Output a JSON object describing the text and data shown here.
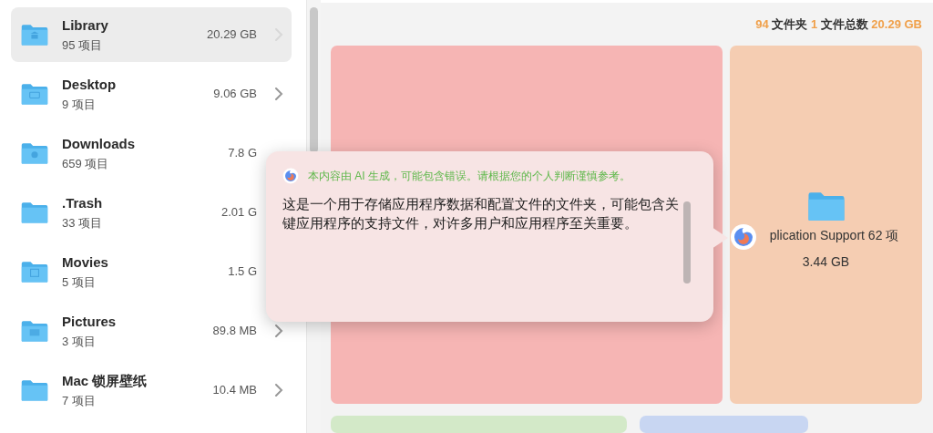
{
  "folders": [
    {
      "name": "Library",
      "count": "95 项目",
      "size": "20.29 GB",
      "kind": "library",
      "selected": true,
      "chevron": true
    },
    {
      "name": "Desktop",
      "count": "9 项目",
      "size": "9.06 GB",
      "kind": "desktop",
      "selected": false,
      "chevron": true
    },
    {
      "name": "Downloads",
      "count": "659 项目",
      "size": "7.8 G",
      "kind": "downloads",
      "selected": false,
      "chevron": false
    },
    {
      "name": ".Trash",
      "count": "33 项目",
      "size": "2.01 G",
      "kind": "plain",
      "selected": false,
      "chevron": false
    },
    {
      "name": "Movies",
      "count": "5 项目",
      "size": "1.5 G",
      "kind": "movies",
      "selected": false,
      "chevron": false
    },
    {
      "name": "Pictures",
      "count": "3 项目",
      "size": "89.8 MB",
      "kind": "pictures",
      "selected": false,
      "chevron": true
    },
    {
      "name": "Mac 锁屏壁纸",
      "count": "7 项目",
      "size": "10.4 MB",
      "kind": "plain",
      "selected": false,
      "chevron": true
    }
  ],
  "summary": {
    "folder_count": "94",
    "folder_label": "文件夹",
    "file_count": "1",
    "file_label": "文件总数",
    "total": "20.29 GB"
  },
  "tiles": [
    {
      "color": "#f6b5b4"
    },
    {
      "color": "#f5cdb2",
      "name": "plication Support 62 项",
      "size": "3.44 GB"
    }
  ],
  "lower_tiles": [
    {
      "color": "#d3e9c8"
    },
    {
      "color": "#c8d6f2"
    }
  ],
  "popover": {
    "notice": "本内容由 AI 生成，可能包含错误。请根据您的个人判断谨慎参考。",
    "text": "这是一个用于存储应用程序数据和配置文件的文件夹，可能包含关键应用程序的支持文件，对许多用户和应用程序至关重要。"
  }
}
